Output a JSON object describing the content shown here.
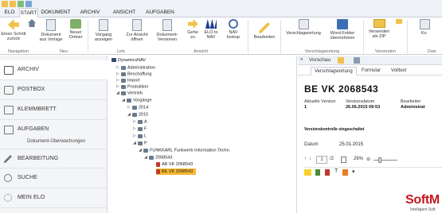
{
  "ribbon_tabs": [
    "ELO",
    "START",
    "DOKUMENT",
    "ARCHIV",
    "ANSICHT",
    "AUFGABEN"
  ],
  "ribbon": {
    "buttons": {
      "einen_schritt": "Einen Schritt\nzurück",
      "home": "",
      "dokument_aus_vorlage": "Dokument\naus Vorlage",
      "neuer_ordner": "Neuer\nOrdner",
      "vorgang_anzeigen": "Vorgang\nanzeigen",
      "zur_ansicht": "Zur Ansicht\nöffnen",
      "dokument_versionen": "Dokument-\nVersionen",
      "gehe_zu": "Gehe\nzu",
      "elo_to_nav": "ELO to\nNAV",
      "nav_lookup": "NAV\nlookup",
      "bearbeiten": "Bearbeiten",
      "verschlagwortung": "Verschlagwortung",
      "wordfelder": "Word-Felder\nübernehmen",
      "versenden_zip": "Versenden\nals ZIP",
      "kopieren": "Ko"
    },
    "groups": [
      "Navigation",
      "Neu",
      "Link",
      "Ansicht",
      "Verschlagwortung",
      "Versenden",
      "Zwis"
    ]
  },
  "sidebar": {
    "items": [
      "ARCHIV",
      "POSTBOX",
      "KLEMMBRETT",
      "AUFGABEN",
      "BEARBEITUNG",
      "SUCHE",
      "MEIN ELO"
    ],
    "subitem": "Dokument-Überwachungen"
  },
  "tree": {
    "nodes": [
      "DynamicsNAV",
      "Administration",
      "Beschaffung",
      "Import",
      "Produktion",
      "Vertrieb",
      "Vorgänge",
      "2014",
      "2015",
      "A",
      "F",
      "L",
      "P",
      "FUNKKARL Funkwerk Information Techn.",
      "2068543",
      "AB VK 2068543",
      "BE VK 2068543"
    ]
  },
  "preview": {
    "header": "Vorschau",
    "tabs": [
      "Verschlagwortung",
      "Formular",
      "Volltext"
    ],
    "title": "BE VK 2068543",
    "fields": {
      "version_label": "Aktuelle Version",
      "version_value": "1",
      "date_label": "Versionsdatum",
      "date_value": "26.06.2015 09:53",
      "editor_label": "Bearbeiter",
      "editor_value": "Administrat"
    },
    "note": "Versionskontrolle eingeschaltet",
    "datum_label": "Datum",
    "datum_value": "25.01.2015",
    "page_current": "1",
    "page_total": "/2",
    "zoom": "26%",
    "logo_text": "SoftM",
    "logo_sub": "Intelligent Soft"
  },
  "colors": {
    "accent": "#f7b731",
    "brand_red": "#c4161c"
  }
}
